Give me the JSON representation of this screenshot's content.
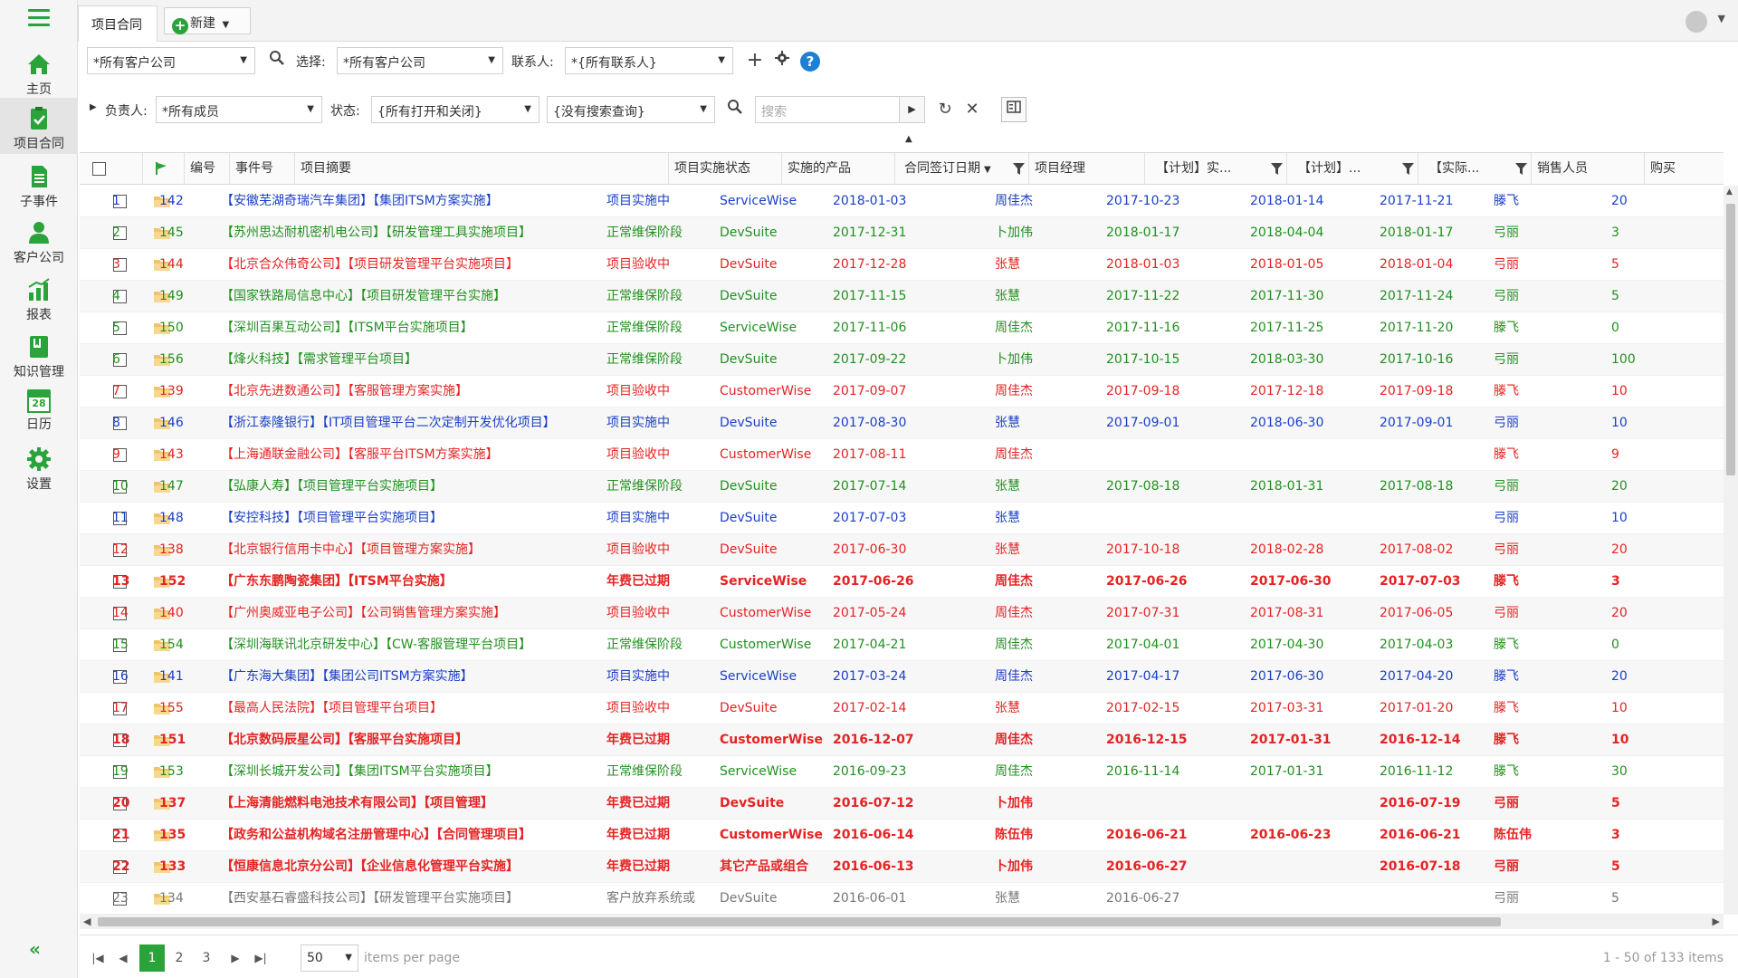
{
  "sidebar": {
    "items": [
      {
        "label": "主页",
        "icon": "home-icon"
      },
      {
        "label": "项目合同",
        "icon": "checklist-icon"
      },
      {
        "label": "子事件",
        "icon": "document-icon"
      },
      {
        "label": "客户公司",
        "icon": "person-icon"
      },
      {
        "label": "报表",
        "icon": "bar-chart-icon"
      },
      {
        "label": "知识管理",
        "icon": "book-icon"
      },
      {
        "label": "日历",
        "icon": "calendar-icon",
        "day": "28"
      },
      {
        "label": "设置",
        "icon": "gear-icon"
      }
    ],
    "collapse": "«",
    "accent": "#2aa33a"
  },
  "tabs": {
    "active": "项目合同",
    "new_label": "新建"
  },
  "filters": {
    "company": "*所有客户公司",
    "select_label": "选择:",
    "select_value": "*所有客户公司",
    "contact_label": "联系人:",
    "contact_value": "*{所有联系人}",
    "owner_label": "负责人:",
    "owner_value": "*所有成员",
    "status_label": "状态:",
    "status_value": "{所有打开和关闭}",
    "query_value": "{没有搜索查询}",
    "search_placeholder": "搜索"
  },
  "columns": [
    "编号",
    "事件号",
    "项目摘要",
    "项目实施状态",
    "实施的产品",
    "合同签订日期",
    "项目经理",
    "【计划】实...",
    "【计划】...",
    "【实际...",
    "销售人员",
    "购买"
  ],
  "rows": [
    {
      "color": "blue",
      "bold": false,
      "no": "1",
      "id": "142",
      "summary": "【安徽芜湖奇瑞汽车集团】【集团ITSM方案实施】",
      "status": "项目实施中",
      "product": "ServiceWise",
      "date": "2018-01-03",
      "pm": "周佳杰",
      "p1": "2017-10-23",
      "p2": "2018-01-14",
      "act": "2017-11-21",
      "sales": "滕飞",
      "buy": "20"
    },
    {
      "color": "green",
      "bold": false,
      "no": "2",
      "id": "145",
      "summary": "【苏州思达耐机密机电公司】【研发管理工具实施项目】",
      "status": "正常维保阶段",
      "product": "DevSuite",
      "date": "2017-12-31",
      "pm": "卜加伟",
      "p1": "2018-01-17",
      "p2": "2018-04-04",
      "act": "2018-01-17",
      "sales": "弓丽",
      "buy": "3"
    },
    {
      "color": "red",
      "bold": false,
      "no": "3",
      "id": "144",
      "summary": "【北京合众伟奇公司】【项目研发管理平台实施项目】",
      "status": "项目验收中",
      "product": "DevSuite",
      "date": "2017-12-28",
      "pm": "张慧",
      "p1": "2018-01-03",
      "p2": "2018-01-05",
      "act": "2018-01-04",
      "sales": "弓丽",
      "buy": "5"
    },
    {
      "color": "green",
      "bold": false,
      "no": "4",
      "id": "149",
      "summary": "【国家铁路局信息中心】【项目研发管理平台实施】",
      "status": "正常维保阶段",
      "product": "DevSuite",
      "date": "2017-11-15",
      "pm": "张慧",
      "p1": "2017-11-22",
      "p2": "2017-11-30",
      "act": "2017-11-24",
      "sales": "弓丽",
      "buy": "5"
    },
    {
      "color": "green",
      "bold": false,
      "no": "5",
      "id": "150",
      "summary": "【深圳百果互动公司】【ITSM平台实施项目】",
      "status": "正常维保阶段",
      "product": "ServiceWise",
      "date": "2017-11-06",
      "pm": "周佳杰",
      "p1": "2017-11-16",
      "p2": "2017-11-25",
      "act": "2017-11-20",
      "sales": "滕飞",
      "buy": "0"
    },
    {
      "color": "green",
      "bold": false,
      "no": "6",
      "id": "156",
      "summary": "【烽火科技】【需求管理平台项目】",
      "status": "正常维保阶段",
      "product": "DevSuite",
      "date": "2017-09-22",
      "pm": "卜加伟",
      "p1": "2017-10-15",
      "p2": "2018-03-30",
      "act": "2017-10-16",
      "sales": "弓丽",
      "buy": "100"
    },
    {
      "color": "red",
      "bold": false,
      "no": "7",
      "id": "139",
      "summary": "【北京先进数通公司】【客服管理方案实施】",
      "status": "项目验收中",
      "product": "CustomerWise",
      "date": "2017-09-07",
      "pm": "周佳杰",
      "p1": "2017-09-18",
      "p2": "2017-12-18",
      "act": "2017-09-18",
      "sales": "滕飞",
      "buy": "10"
    },
    {
      "color": "blue",
      "bold": false,
      "no": "8",
      "id": "146",
      "summary": "【浙江泰隆银行】【IT项目管理平台二次定制开发优化项目】",
      "status": "项目实施中",
      "product": "DevSuite",
      "date": "2017-08-30",
      "pm": "张慧",
      "p1": "2017-09-01",
      "p2": "2018-06-30",
      "act": "2017-09-01",
      "sales": "弓丽",
      "buy": "10"
    },
    {
      "color": "red",
      "bold": false,
      "no": "9",
      "id": "143",
      "summary": "【上海通联金融公司】【客服平台ITSM方案实施】",
      "status": "项目验收中",
      "product": "CustomerWise",
      "date": "2017-08-11",
      "pm": "周佳杰",
      "p1": "",
      "p2": "",
      "act": "",
      "sales": "滕飞",
      "buy": "9"
    },
    {
      "color": "green",
      "bold": false,
      "no": "10",
      "id": "147",
      "summary": "【弘康人寿】【项目管理平台实施项目】",
      "status": "正常维保阶段",
      "product": "DevSuite",
      "date": "2017-07-14",
      "pm": "张慧",
      "p1": "2017-08-18",
      "p2": "2018-01-31",
      "act": "2017-08-18",
      "sales": "弓丽",
      "buy": "20"
    },
    {
      "color": "blue",
      "bold": false,
      "no": "11",
      "id": "148",
      "summary": "【安控科技】【项目管理平台实施项目】",
      "status": "项目实施中",
      "product": "DevSuite",
      "date": "2017-07-03",
      "pm": "张慧",
      "p1": "",
      "p2": "",
      "act": "",
      "sales": "弓丽",
      "buy": "10"
    },
    {
      "color": "red",
      "bold": false,
      "no": "12",
      "id": "138",
      "summary": "【北京银行信用卡中心】【项目管理方案实施】",
      "status": "项目验收中",
      "product": "DevSuite",
      "date": "2017-06-30",
      "pm": "张慧",
      "p1": "2017-10-18",
      "p2": "2018-02-28",
      "act": "2017-08-02",
      "sales": "弓丽",
      "buy": "20"
    },
    {
      "color": "red",
      "bold": true,
      "no": "13",
      "id": "152",
      "summary": "【广东东鹏陶瓷集团】【ITSM平台实施】",
      "status": "年费已过期",
      "product": "ServiceWise",
      "date": "2017-06-26",
      "pm": "周佳杰",
      "p1": "2017-06-26",
      "p2": "2017-06-30",
      "act": "2017-07-03",
      "sales": "滕飞",
      "buy": "3"
    },
    {
      "color": "red",
      "bold": false,
      "no": "14",
      "id": "140",
      "summary": "【广州奥威亚电子公司】【公司销售管理方案实施】",
      "status": "项目验收中",
      "product": "CustomerWise",
      "date": "2017-05-24",
      "pm": "周佳杰",
      "p1": "2017-07-31",
      "p2": "2017-08-31",
      "act": "2017-06-05",
      "sales": "弓丽",
      "buy": "20"
    },
    {
      "color": "green",
      "bold": false,
      "no": "15",
      "id": "154",
      "summary": "【深圳海联讯北京研发中心】【CW-客服管理平台项目】",
      "status": "正常维保阶段",
      "product": "CustomerWise",
      "date": "2017-04-21",
      "pm": "周佳杰",
      "p1": "2017-04-01",
      "p2": "2017-04-30",
      "act": "2017-04-03",
      "sales": "滕飞",
      "buy": "0"
    },
    {
      "color": "blue",
      "bold": false,
      "no": "16",
      "id": "141",
      "summary": "【广东海大集团】【集团公司ITSM方案实施】",
      "status": "项目实施中",
      "product": "ServiceWise",
      "date": "2017-03-24",
      "pm": "周佳杰",
      "p1": "2017-04-17",
      "p2": "2017-06-30",
      "act": "2017-04-20",
      "sales": "滕飞",
      "buy": "20"
    },
    {
      "color": "red",
      "bold": false,
      "no": "17",
      "id": "155",
      "summary": "【最高人民法院】【项目管理平台项目】",
      "status": "项目验收中",
      "product": "DevSuite",
      "date": "2017-02-14",
      "pm": "张慧",
      "p1": "2017-02-15",
      "p2": "2017-03-31",
      "act": "2017-01-20",
      "sales": "滕飞",
      "buy": "10"
    },
    {
      "color": "red",
      "bold": true,
      "no": "18",
      "id": "151",
      "summary": "【北京数码辰星公司】【客服平台实施项目】",
      "status": "年费已过期",
      "product": "CustomerWise",
      "date": "2016-12-07",
      "pm": "周佳杰",
      "p1": "2016-12-15",
      "p2": "2017-01-31",
      "act": "2016-12-14",
      "sales": "滕飞",
      "buy": "10"
    },
    {
      "color": "green",
      "bold": false,
      "no": "19",
      "id": "153",
      "summary": "【深圳长城开发公司】【集团ITSM平台实施项目】",
      "status": "正常维保阶段",
      "product": "ServiceWise",
      "date": "2016-09-23",
      "pm": "周佳杰",
      "p1": "2016-11-14",
      "p2": "2017-01-31",
      "act": "2016-11-12",
      "sales": "滕飞",
      "buy": "30"
    },
    {
      "color": "red",
      "bold": true,
      "no": "20",
      "id": "137",
      "summary": "【上海清能燃料电池技术有限公司】【项目管理】",
      "status": "年费已过期",
      "product": "DevSuite",
      "date": "2016-07-12",
      "pm": "卜加伟",
      "p1": "",
      "p2": "",
      "act": "2016-07-19",
      "sales": "弓丽",
      "buy": "5"
    },
    {
      "color": "red",
      "bold": true,
      "no": "21",
      "id": "135",
      "summary": "【政务和公益机构域名注册管理中心】【合同管理项目】",
      "status": "年费已过期",
      "product": "CustomerWise",
      "date": "2016-06-14",
      "pm": "陈伍伟",
      "p1": "2016-06-21",
      "p2": "2016-06-23",
      "act": "2016-06-21",
      "sales": "陈伍伟",
      "buy": "3"
    },
    {
      "color": "red",
      "bold": true,
      "no": "22",
      "id": "133",
      "summary": "【恒康信息北京分公司】【企业信息化管理平台实施】",
      "status": "年费已过期",
      "product": "其它产品或组合",
      "date": "2016-06-13",
      "pm": "卜加伟",
      "p1": "2016-06-27",
      "p2": "",
      "act": "2016-07-18",
      "sales": "弓丽",
      "buy": "5"
    },
    {
      "color": "gray",
      "bold": false,
      "no": "23",
      "id": "134",
      "summary": "【西安基石睿盛科技公司】【研发管理平台实施项目】",
      "status": "客户放弃系统或",
      "product": "DevSuite",
      "date": "2016-06-01",
      "pm": "张慧",
      "p1": "2016-06-27",
      "p2": "",
      "act": "",
      "sales": "弓丽",
      "buy": "5"
    }
  ],
  "pager": {
    "pages": [
      "1",
      "2",
      "3"
    ],
    "page_size": "50",
    "items_label": "items per page",
    "info": "1 - 50 of 133 items"
  }
}
